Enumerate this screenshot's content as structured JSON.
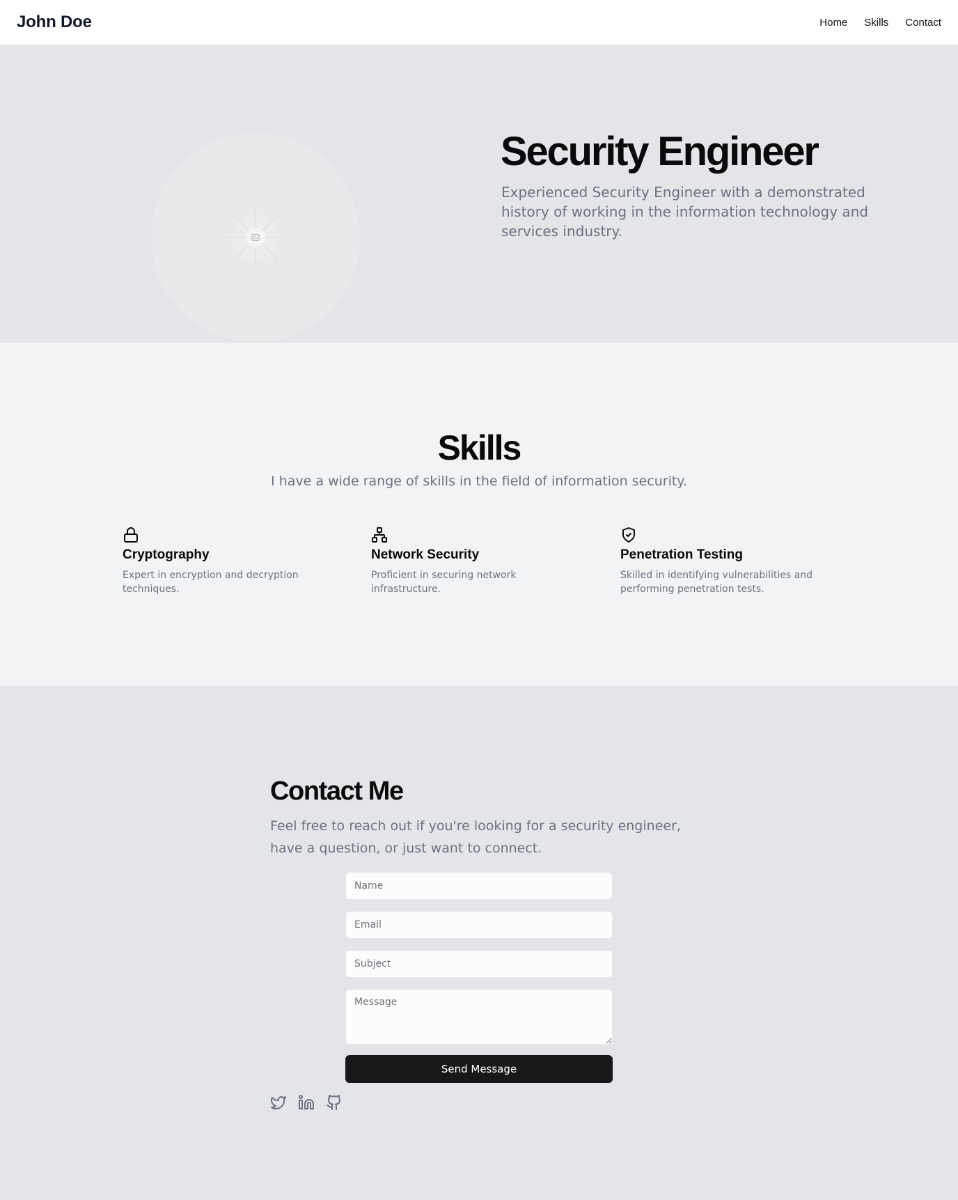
{
  "header": {
    "brand": "John Doe",
    "nav": [
      "Home",
      "Skills",
      "Contact"
    ]
  },
  "hero": {
    "avatar_icon": "image-placeholder-icon",
    "title": "Security Engineer",
    "description": "Experienced Security Engineer with a demonstrated history of working in the information technology and services industry."
  },
  "skills": {
    "title": "Skills",
    "subtitle": "I have a wide range of skills in the field of information security.",
    "items": [
      {
        "icon": "lock-icon",
        "name": "Cryptography",
        "description": "Expert in encryption and decryption techniques."
      },
      {
        "icon": "network-icon",
        "name": "Network Security",
        "description": "Proficient in securing network infrastructure."
      },
      {
        "icon": "shield-check-icon",
        "name": "Penetration Testing",
        "description": "Skilled in identifying vulnerabilities and performing penetration tests."
      }
    ]
  },
  "contact": {
    "title": "Contact Me",
    "description": "Feel free to reach out if you're looking for a security engineer, have a question, or just want to connect.",
    "fields": {
      "name_placeholder": "Name",
      "email_placeholder": "Email",
      "subject_placeholder": "Subject",
      "message_placeholder": "Message"
    },
    "submit_label": "Send Message",
    "socials": [
      "twitter-icon",
      "linkedin-icon",
      "github-icon"
    ]
  },
  "colors": {
    "header_bg": "#ffffff",
    "hero_bg": "#e4e5e9",
    "skills_bg": "#f2f3f5",
    "contact_bg": "#e4e5e9",
    "muted_text": "#6b7280",
    "button_bg": "#18181b"
  }
}
